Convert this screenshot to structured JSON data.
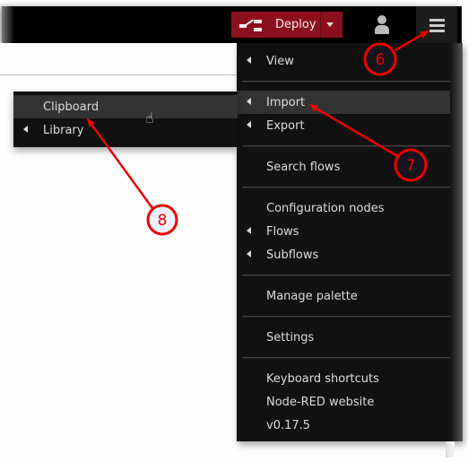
{
  "header": {
    "deploy": {
      "label": "Deploy",
      "icon": "deploy-flow-icon",
      "dropdown_icon": "caret-down-icon",
      "color": "#8c101c"
    },
    "user_icon": "user-icon",
    "menu_icon": "hamburger-menu-icon"
  },
  "main_menu": {
    "items": [
      {
        "label": "View",
        "submenu": true,
        "active": false
      },
      {
        "label": "Import",
        "submenu": true,
        "active": true
      },
      {
        "label": "Export",
        "submenu": true,
        "active": false
      },
      {
        "label": "Search flows",
        "submenu": false,
        "active": false
      },
      {
        "label": "Configuration nodes",
        "submenu": false,
        "active": false
      },
      {
        "label": "Flows",
        "submenu": true,
        "active": false
      },
      {
        "label": "Subflows",
        "submenu": true,
        "active": false
      },
      {
        "label": "Manage palette",
        "submenu": false,
        "active": false
      },
      {
        "label": "Settings",
        "submenu": false,
        "active": false
      },
      {
        "label": "Keyboard shortcuts",
        "submenu": false,
        "active": false
      },
      {
        "label": "Node-RED website",
        "submenu": false,
        "active": false
      },
      {
        "label": "v0.17.5",
        "submenu": false,
        "active": false
      }
    ]
  },
  "import_submenu": {
    "items": [
      {
        "label": "Clipboard",
        "submenu": false,
        "active": true
      },
      {
        "label": "Library",
        "submenu": true,
        "active": false
      }
    ]
  },
  "annotations": {
    "badges": [
      "6",
      "7",
      "8"
    ],
    "color": "#ee0000"
  },
  "cursor": "pointer-hand-cursor"
}
